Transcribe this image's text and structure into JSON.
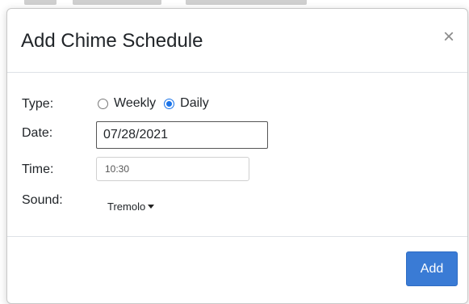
{
  "dialog": {
    "title": "Add Chime Schedule",
    "close_label": "×"
  },
  "form": {
    "type": {
      "label": "Type:",
      "options": [
        {
          "label": "Weekly",
          "checked": false
        },
        {
          "label": "Daily",
          "checked": true
        }
      ]
    },
    "date": {
      "label": "Date:",
      "value": "07/28/2021"
    },
    "time": {
      "label": "Time:",
      "value": "10:30"
    },
    "sound": {
      "label": "Sound:",
      "selected": "Tremolo"
    }
  },
  "footer": {
    "add_label": "Add"
  },
  "colors": {
    "accent": "#3a7bd5",
    "radio_checked": "#1a73e8"
  }
}
